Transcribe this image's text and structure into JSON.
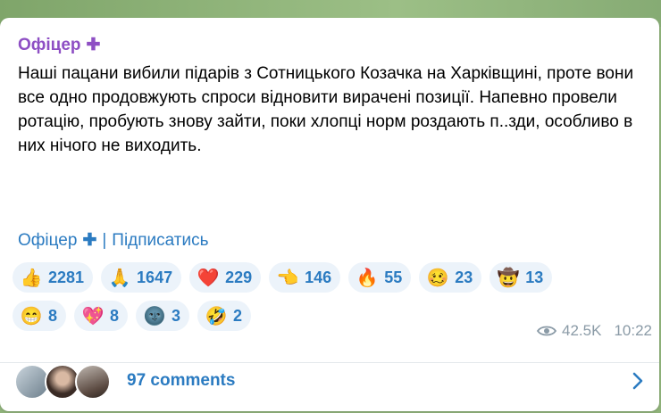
{
  "post": {
    "sender": "Офіцер",
    "text": "Наші пацани вибили підарів з Сотницького Козачка на Харківщині, проте вони все одно продовжують спроси відновити вирачені позиції. Напевно провели ротацію, пробують знову зайти, поки хлопці норм роздають п..зди, особливо в них нічого не виходить.",
    "signature_name": "Офіцер",
    "signature_sep": "|",
    "subscribe_label": "Підписатись",
    "views": "42.5K",
    "time": "10:22"
  },
  "reactions_row1": [
    {
      "icon": "thumbs-up-icon",
      "glyph": "👍",
      "count": "2281"
    },
    {
      "icon": "praying-hands-icon",
      "glyph": "🙏",
      "count": "1647"
    },
    {
      "icon": "red-heart-icon",
      "glyph": "❤️",
      "count": "229"
    },
    {
      "icon": "pointing-hand-icon",
      "glyph": "👈",
      "count": "146"
    },
    {
      "icon": "fire-icon",
      "glyph": "🔥",
      "count": "55"
    },
    {
      "icon": "woozy-face-icon",
      "glyph": "🥴",
      "count": "23"
    },
    {
      "icon": "cowboy-sticker-icon",
      "glyph": "🤠",
      "count": "13"
    }
  ],
  "reactions_row2": [
    {
      "icon": "grinning-face-icon",
      "glyph": "😁",
      "count": "8"
    },
    {
      "icon": "sparkling-heart-icon",
      "glyph": "💖",
      "count": "8"
    },
    {
      "icon": "new-moon-face-icon",
      "glyph": "🌚",
      "count": "3"
    },
    {
      "icon": "rofl-face-icon",
      "glyph": "🤣",
      "count": "2"
    }
  ],
  "comments": {
    "label": "97 comments"
  },
  "colors": {
    "accent": "#2b7bc1",
    "sender": "#8e4fc4",
    "reaction_bg": "#ecf3fa"
  }
}
